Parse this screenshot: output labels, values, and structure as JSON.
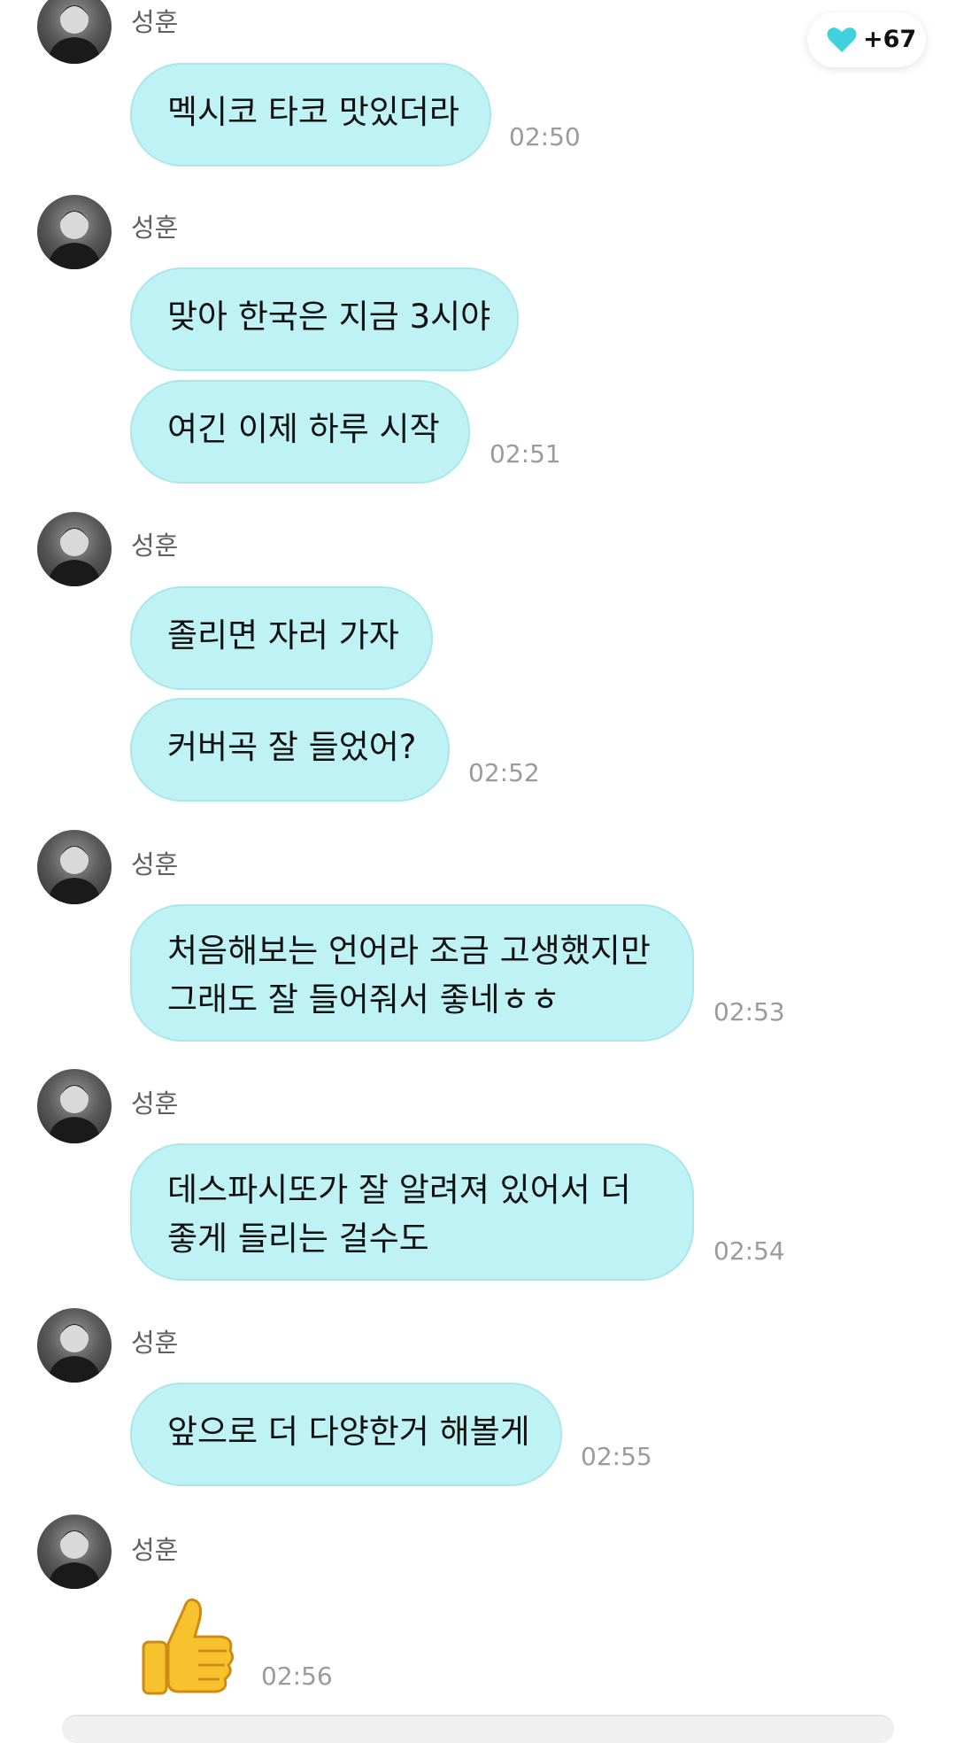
{
  "sender_name": "성훈",
  "hearts": {
    "count": "+67",
    "icon": "heart-icon",
    "color": "#3fd1dd"
  },
  "messages": [
    {
      "lines": [
        "멕시코 타코 맛있더라"
      ],
      "time": "02:50"
    },
    {
      "lines": [
        "맞아 한국은 지금 3시야",
        "여긴 이제 하루 시작"
      ],
      "time": "02:51"
    },
    {
      "lines": [
        "졸리면 자러 가자",
        "커버곡 잘 들었어?"
      ],
      "time": "02:52"
    },
    {
      "lines": [
        "처음해보는 언어라 조금 고생했지만",
        "그래도 잘 들어줘서 좋네ㅎㅎ"
      ],
      "time": "02:53"
    },
    {
      "lines": [
        "데스파시또가 잘 알려져 있어서 더",
        "좋게 들리는 걸수도"
      ],
      "time": "02:54"
    },
    {
      "lines": [
        "앞으로 더 다양한거 해볼게"
      ],
      "time": "02:55"
    },
    {
      "emoji": "thumbs-up",
      "time": "02:56"
    }
  ],
  "colors": {
    "bubble": "#bff2f4",
    "bubble_border": "#a9e7ea",
    "timestamp": "#9b9b9b",
    "sender": "#5f5f5f"
  }
}
